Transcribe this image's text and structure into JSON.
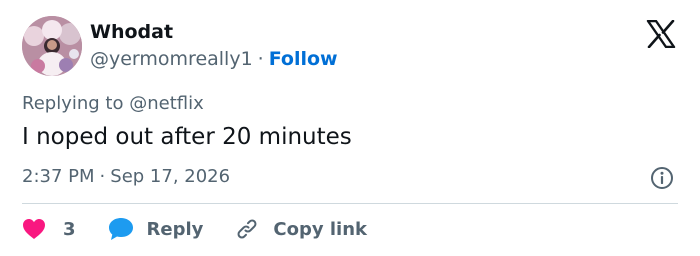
{
  "author": {
    "display_name": "Whodat",
    "handle": "@yermomreally1",
    "separator": "·",
    "follow_label": "Follow"
  },
  "reply_context": {
    "prefix": "Replying to",
    "mention": "@netflix"
  },
  "tweet": {
    "text": "I noped out after 20 minutes",
    "time": "2:37 PM",
    "separator": "·",
    "date": "Sep 17, 2026"
  },
  "actions": {
    "like_count": "3",
    "reply_label": "Reply",
    "copy_link_label": "Copy link"
  },
  "icons": {
    "brand": "x-logo-icon",
    "info": "info-icon",
    "like": "heart-icon",
    "reply": "speech-bubble-icon",
    "copy": "link-icon"
  },
  "colors": {
    "text_primary": "#0f1419",
    "text_secondary": "#536471",
    "link": "#006fd6",
    "like": "#f91880",
    "reply_icon": "#1d9bf0",
    "divider": "#cfd9de"
  }
}
